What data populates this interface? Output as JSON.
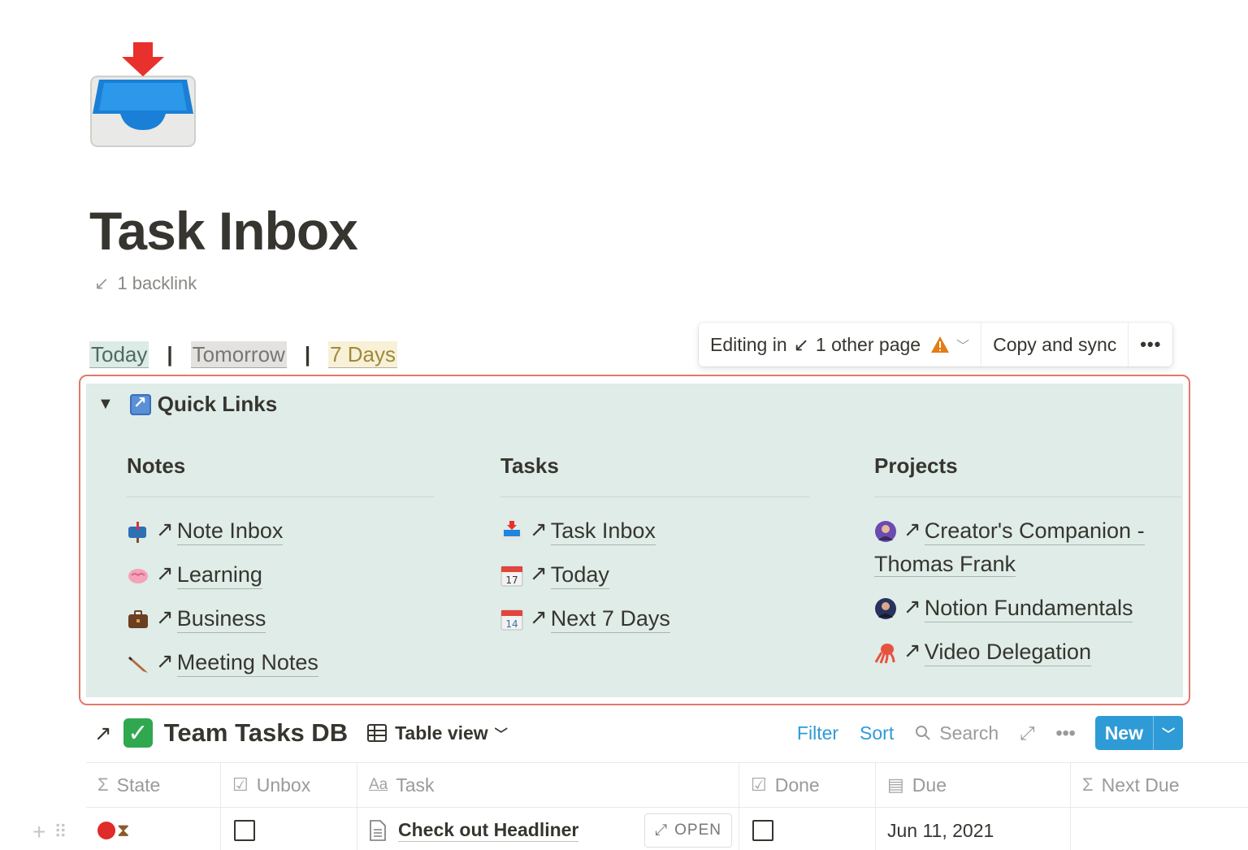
{
  "page": {
    "title": "Task Inbox",
    "icon": "inbox-tray-icon",
    "backlink_label": "1 backlink"
  },
  "nav_links": [
    {
      "label": "Today",
      "color": "#dcebe6"
    },
    {
      "label": "Tomorrow",
      "color": "#e3e2e0"
    },
    {
      "label": "7 Days",
      "color": "#f8f1d8"
    }
  ],
  "nav_separator": "|",
  "sync_bar": {
    "editing_label": "Editing in",
    "other_page_label": "1 other page",
    "copy_sync_label": "Copy and sync",
    "more_label": "•••"
  },
  "quick_links": {
    "title": "Quick Links",
    "columns": [
      {
        "heading": "Notes",
        "items": [
          {
            "label": "Note Inbox",
            "icon": "mailbox-icon"
          },
          {
            "label": "Learning",
            "icon": "brain-icon"
          },
          {
            "label": "Business",
            "icon": "briefcase-icon"
          },
          {
            "label": "Meeting Notes",
            "icon": "pencil-icon"
          }
        ]
      },
      {
        "heading": "Tasks",
        "items": [
          {
            "label": "Task Inbox",
            "icon": "inbox-tray-icon"
          },
          {
            "label": "Today",
            "icon": "calendar-17-icon"
          },
          {
            "label": "Next 7 Days",
            "icon": "calendar-14-icon"
          }
        ]
      },
      {
        "heading": "Projects",
        "items": [
          {
            "label_line1": "Creator's Companion -",
            "label_line2": "Thomas Frank",
            "icon": "avatar-icon"
          },
          {
            "label": "Notion Fundamentals",
            "icon": "avatar-icon"
          },
          {
            "label": "Video Delegation",
            "icon": "octopus-icon"
          }
        ]
      }
    ]
  },
  "database": {
    "title": "Team Tasks DB",
    "view_label": "Table view",
    "filter_label": "Filter",
    "sort_label": "Sort",
    "search_label": "Search",
    "new_label": "New",
    "columns": [
      {
        "label": "State",
        "icon": "sigma-icon"
      },
      {
        "label": "Unbox",
        "icon": "checkbox-icon"
      },
      {
        "label": "Task",
        "icon": "text-aa-icon"
      },
      {
        "label": "Done",
        "icon": "checkbox-icon"
      },
      {
        "label": "Due",
        "icon": "calendar-icon"
      },
      {
        "label": "Next Due",
        "icon": "sigma-icon"
      }
    ],
    "rows": [
      {
        "task": "Check out Headliner",
        "open_label": "OPEN",
        "due": "Jun 11, 2021",
        "unbox": false,
        "done": false
      }
    ]
  },
  "colors": {
    "accent": "#2e9bd6",
    "callout_bg": "#dfece8",
    "synced_outline": "#e2796a"
  }
}
